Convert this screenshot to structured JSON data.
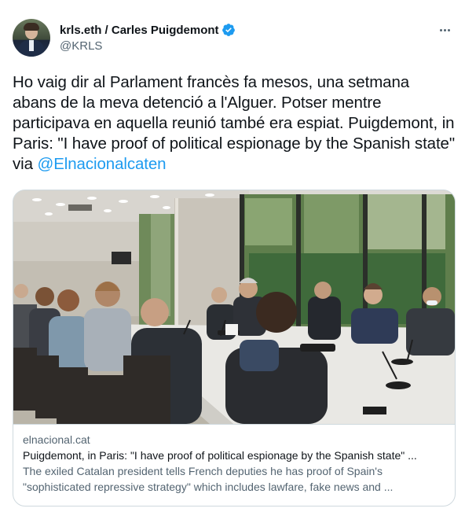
{
  "author": {
    "display_name": "krls.eth / Carles Puigdemont",
    "handle": "@KRLS",
    "verified": true
  },
  "tweet": {
    "text_before_mention": "Ho vaig dir al Parlament francès fa mesos, una setmana abans de la meva detenció a l'Alguer. Potser mentre participava en aquella reunió també era espiat. Puigdemont, in Paris: \"I have proof of political espionage by the Spanish state\" via ",
    "mention": "@Elnacionalcaten"
  },
  "link_card": {
    "domain": "elnacional.cat",
    "title": "Puigdemont, in Paris: \"I have proof of political espionage by the Spanish state\" ...",
    "description": "The exiled Catalan president tells French deputies he has proof of Spain's \"sophisticated repressive strategy\" which includes lawfare, fake news and ..."
  },
  "icons": {
    "verified": "verified-badge-icon",
    "more": "more-options-icon"
  },
  "colors": {
    "accent": "#1d9bf0",
    "text_primary": "#0f1419",
    "text_secondary": "#536471",
    "border": "#cfd9de"
  }
}
